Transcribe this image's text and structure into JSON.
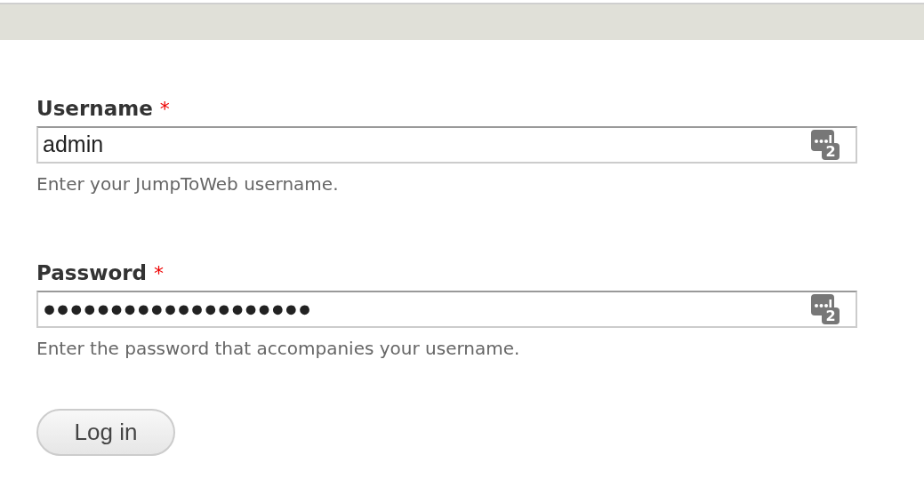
{
  "fields": [
    {
      "label": "Username",
      "required_mark": "*",
      "value": "admin",
      "icon_badge": "2",
      "help": "Enter your JumpToWeb username."
    },
    {
      "label": "Password",
      "required_mark": "*",
      "value": "●●●●●●●●●●●●●●●●●●●●",
      "icon_badge": "2",
      "help": "Enter the password that accompanies your username."
    }
  ],
  "submit": "Log in"
}
